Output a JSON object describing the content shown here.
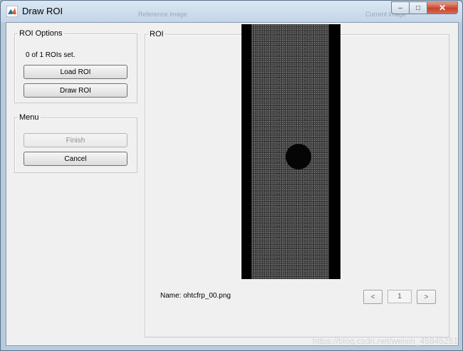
{
  "window": {
    "title": "Draw ROI",
    "behind_labels": [
      "Reference image",
      "Current image"
    ]
  },
  "titlebar_buttons": {
    "minimize": "–",
    "maximize": "□",
    "close": "✕"
  },
  "roi_options": {
    "label": "ROI Options",
    "status": "0 of 1 ROIs set.",
    "load_button": "Load ROI",
    "draw_button": "Draw ROI"
  },
  "menu": {
    "label": "Menu",
    "finish_button": "Finish",
    "cancel_button": "Cancel"
  },
  "roi_panel": {
    "label": "ROI",
    "image_name": "Name: ohtcfrp_00.png",
    "prev_button": "<",
    "next_button": ">",
    "page_value": "1"
  },
  "watermark": "https://blog.csdn.net/weixin_45845251",
  "colors": {
    "window_bg": "#f0f0f0",
    "titlebar": "#c3d5e8",
    "close_button": "#c7452c"
  }
}
